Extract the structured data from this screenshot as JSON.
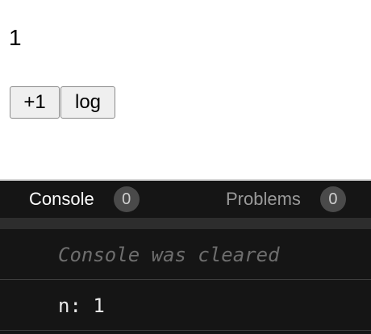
{
  "preview": {
    "count": "1",
    "buttons": {
      "increment_label": "+1",
      "log_label": "log"
    }
  },
  "devtools": {
    "tabs": [
      {
        "label": "Console",
        "badge": "0",
        "active": true
      },
      {
        "label": "Problems",
        "badge": "0",
        "active": false
      }
    ],
    "console": {
      "lines": [
        {
          "text": "Console was cleared",
          "kind": "info"
        },
        {
          "text": "n: 1",
          "kind": "log"
        }
      ]
    }
  },
  "colors": {
    "devtools_bg": "#151515",
    "toolbar_strip": "#2d2d2d",
    "badge_bg": "#4a4a4a",
    "button_bg": "#efefef"
  }
}
